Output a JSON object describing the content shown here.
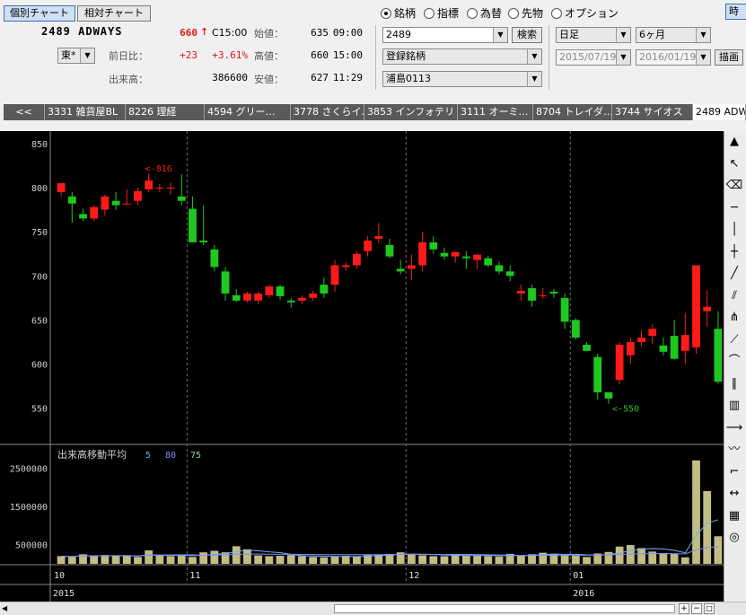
{
  "header": {
    "btn_individual": "個別チャート",
    "btn_relative": "相対チャート",
    "code_name": "2489 ADWAYS",
    "market": "東*",
    "price": "660",
    "arrow": "↑",
    "time": "C15:00",
    "change_label": "前日比：",
    "change": "+23",
    "change_pct": "+3.61%",
    "volume_label": "出来高：",
    "volume": "386600",
    "open_label": "始値：",
    "open_val": "635",
    "open_time": "09:00",
    "high_label": "高値：",
    "high_val": "660",
    "high_time": "15:00",
    "low_label": "安値：",
    "low_val": "627",
    "low_time": "11:29"
  },
  "selector": {
    "radios": [
      "銘柄",
      "指標",
      "為替",
      "先物",
      "オプション"
    ],
    "code": "2489",
    "search": "検索",
    "list": "登録銘柄",
    "portfolio": "浦島0113",
    "period": "日足",
    "span": "6ヶ月",
    "date_from": "2015/07/19",
    "date_to": "2016/01/19",
    "draw": "描画",
    "right_btn": "時"
  },
  "tabs": [
    "<<",
    "3331 雑貨屋BL",
    "8226 理経",
    "4594 グリー…",
    "3778 さくらイ…",
    "3853 インフォテリ",
    "3111 オーミ…",
    "8704 トレイダ…",
    "3744 サイオス",
    "2489 ADW"
  ],
  "chart_data": {
    "type": "candlestick",
    "ylim": [
      510,
      860
    ],
    "yticks": [
      850,
      800,
      750,
      700,
      650,
      600,
      550
    ],
    "volume_ylim": [
      0,
      3000000
    ],
    "volume_ticks": [
      "2500000",
      "1500000",
      "500000"
    ],
    "volume_legend": "出来高移動平均",
    "ma_labels": [
      "5",
      "80",
      "75"
    ],
    "x_month_labels": [
      "10",
      "11",
      "12",
      "01"
    ],
    "x_year_labels": [
      "2015",
      "2016"
    ],
    "annotation_high": "<-816",
    "annotation_low": "<-550",
    "candles": [
      [
        795,
        805,
        790,
        805
      ],
      [
        790,
        795,
        760,
        782
      ],
      [
        770,
        776,
        762,
        765
      ],
      [
        765,
        780,
        762,
        778
      ],
      [
        775,
        792,
        768,
        790
      ],
      [
        785,
        795,
        775,
        780
      ],
      [
        782,
        798,
        780,
        782
      ],
      [
        785,
        800,
        780,
        796
      ],
      [
        798,
        816,
        795,
        808
      ],
      [
        800,
        804,
        795,
        800
      ],
      [
        800,
        806,
        792,
        800
      ],
      [
        790,
        815,
        780,
        785
      ],
      [
        776,
        790,
        740,
        738
      ],
      [
        740,
        780,
        735,
        738
      ],
      [
        730,
        735,
        705,
        710
      ],
      [
        705,
        710,
        672,
        680
      ],
      [
        678,
        685,
        670,
        672
      ],
      [
        672,
        682,
        670,
        680
      ],
      [
        672,
        682,
        668,
        680
      ],
      [
        678,
        690,
        675,
        688
      ],
      [
        688,
        690,
        673,
        677
      ],
      [
        672,
        675,
        664,
        670
      ],
      [
        672,
        678,
        668,
        675
      ],
      [
        675,
        683,
        672,
        680
      ],
      [
        690,
        698,
        675,
        680
      ],
      [
        690,
        718,
        682,
        712
      ],
      [
        710,
        715,
        706,
        712
      ],
      [
        712,
        728,
        708,
        725
      ],
      [
        728,
        745,
        722,
        740
      ],
      [
        742,
        760,
        737,
        745
      ],
      [
        735,
        742,
        720,
        722
      ],
      [
        708,
        718,
        702,
        705
      ],
      [
        708,
        724,
        695,
        712
      ],
      [
        712,
        750,
        705,
        738
      ],
      [
        738,
        745,
        725,
        730
      ],
      [
        726,
        732,
        718,
        722
      ],
      [
        722,
        727,
        715,
        727
      ],
      [
        722,
        728,
        708,
        720
      ],
      [
        718,
        725,
        708,
        724
      ],
      [
        720,
        723,
        710,
        712
      ],
      [
        712,
        716,
        702,
        705
      ],
      [
        705,
        712,
        694,
        700
      ],
      [
        680,
        690,
        672,
        683
      ],
      [
        686,
        690,
        665,
        672
      ],
      [
        678,
        686,
        674,
        678
      ],
      [
        682,
        685,
        675,
        680
      ],
      [
        675,
        680,
        640,
        648
      ],
      [
        650,
        652,
        628,
        630
      ],
      [
        622,
        625,
        618,
        615
      ],
      [
        608,
        612,
        560,
        568
      ],
      [
        568,
        568,
        555,
        561
      ],
      [
        582,
        625,
        577,
        622
      ],
      [
        610,
        630,
        600,
        625
      ],
      [
        625,
        638,
        620,
        630
      ],
      [
        632,
        645,
        623,
        640
      ],
      [
        621,
        630,
        610,
        614
      ],
      [
        632,
        650,
        605,
        606
      ],
      [
        615,
        658,
        600,
        633
      ],
      [
        619,
        708,
        612,
        712
      ],
      [
        660,
        684,
        642,
        665
      ],
      [
        640,
        660,
        578,
        580
      ]
    ],
    "volumes": [
      200000,
      180000,
      250000,
      200000,
      230000,
      210000,
      200000,
      180000,
      350000,
      220000,
      200000,
      220000,
      180000,
      300000,
      340000,
      300000,
      460000,
      380000,
      220000,
      200000,
      210000,
      230000,
      200000,
      180000,
      170000,
      190000,
      210000,
      200000,
      230000,
      240000,
      260000,
      300000,
      240000,
      220000,
      200000,
      200000,
      260000,
      210000,
      210000,
      200000,
      190000,
      260000,
      210000,
      250000,
      290000,
      260000,
      230000,
      210000,
      180000,
      270000,
      310000,
      450000,
      490000,
      410000,
      320000,
      280000,
      260000,
      170000,
      2700000,
      1900000,
      720000
    ]
  },
  "colors": {
    "up": "#ff1a1a",
    "down": "#1fc81f",
    "bg": "#000000",
    "grid": "#6e6e6e",
    "volume": "#c2bd83"
  },
  "toolbar_icons": [
    "scroll-up-icon",
    "pointer-icon",
    "eraser-icon",
    "hline-icon",
    "vline-icon",
    "cross-icon",
    "trendline-icon",
    "channel-icon",
    "pitchfork-icon",
    "fan-icon",
    "arc-icon",
    "parallel-icon",
    "bars-icon",
    "ray-icon",
    "wave-icon",
    "bracket-icon",
    "range-icon",
    "grid-icon",
    "rings-icon"
  ]
}
